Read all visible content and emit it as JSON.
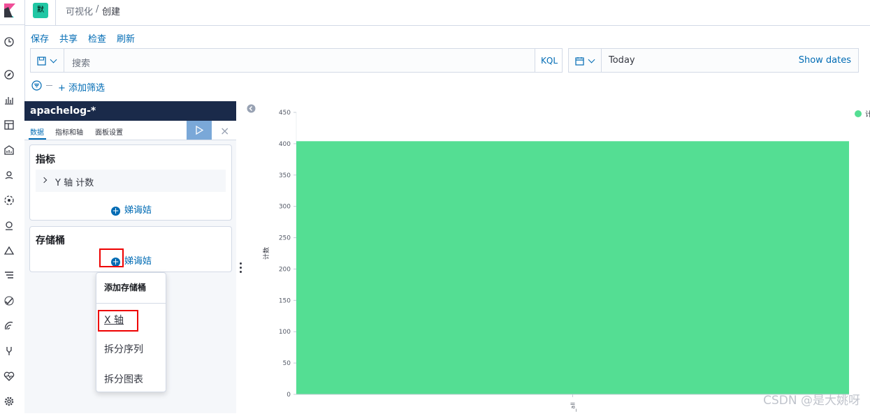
{
  "header": {
    "space_badge": "默",
    "breadcrumb": [
      "可视化",
      "/",
      "创建"
    ]
  },
  "top_nav": [
    "保存",
    "共享",
    "检查",
    "刷新"
  ],
  "query_bar": {
    "search_placeholder": "搜索",
    "language": "KQL",
    "date_value": "Today",
    "show_dates": "Show dates"
  },
  "filter_bar": {
    "add_filter": "+ 添加筛选"
  },
  "sidebar": {
    "index_pattern": "apachelog-*",
    "tabs": [
      "数据",
      "指标和轴",
      "面板设置"
    ],
    "close_icon": "×",
    "metrics": {
      "title": "指标",
      "row": "Y 轴 计数",
      "add_label": "娣诲姞"
    },
    "buckets": {
      "title": "存储桶",
      "add_label": "娣诲姞"
    }
  },
  "popover": {
    "title": "添加存储桶",
    "items": [
      "X 轴",
      "拆分序列",
      "拆分图表"
    ]
  },
  "chart_data": {
    "type": "bar",
    "categories": [
      "_all"
    ],
    "series": [
      {
        "name": "计",
        "values": [
          404
        ]
      }
    ],
    "ylabel": "计数",
    "ylim": [
      0,
      450
    ],
    "yticks": [
      0,
      50,
      100,
      150,
      200,
      250,
      300,
      350,
      400,
      450
    ],
    "xtick_label": "_all",
    "bar_color": "#54de93",
    "legend_position": "top-right"
  },
  "watermark": "CSDN @是大姚呀",
  "colors": {
    "accent": "#006bb4",
    "index_title_bg": "#1a2a4a",
    "bar": "#54de93",
    "highlight": "#ee0000"
  }
}
